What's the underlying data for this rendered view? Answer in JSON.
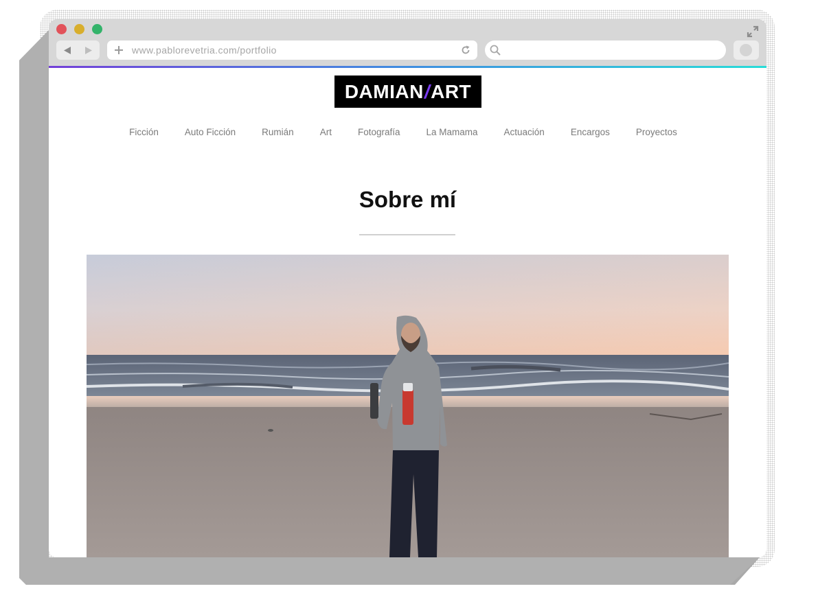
{
  "browser": {
    "url": "www.pablorevetria.com/portfolio",
    "search_placeholder": "",
    "colors": {
      "close": "#e2525a",
      "minimize": "#d8ae2c",
      "maximize": "#33b36a"
    },
    "accent_gradient": [
      "#7340d8",
      "#3f8de0",
      "#28dcd8"
    ]
  },
  "site": {
    "logo_left": "DAMIAN",
    "logo_slash": "/",
    "logo_right": "ART",
    "logo_accent": "#7a3bf0",
    "nav": [
      "Ficción",
      "Auto Ficción",
      "Rumián",
      "Art",
      "Fotografía",
      "La Mamama",
      "Actuación",
      "Encargos",
      "Proyectos"
    ]
  },
  "main": {
    "title": "Sobre mí"
  },
  "icons": {
    "back": "back-arrow-icon",
    "forward": "forward-arrow-icon",
    "new_tab": "plus-icon",
    "reload": "reload-icon",
    "search": "search-icon",
    "expand": "expand-icon"
  }
}
